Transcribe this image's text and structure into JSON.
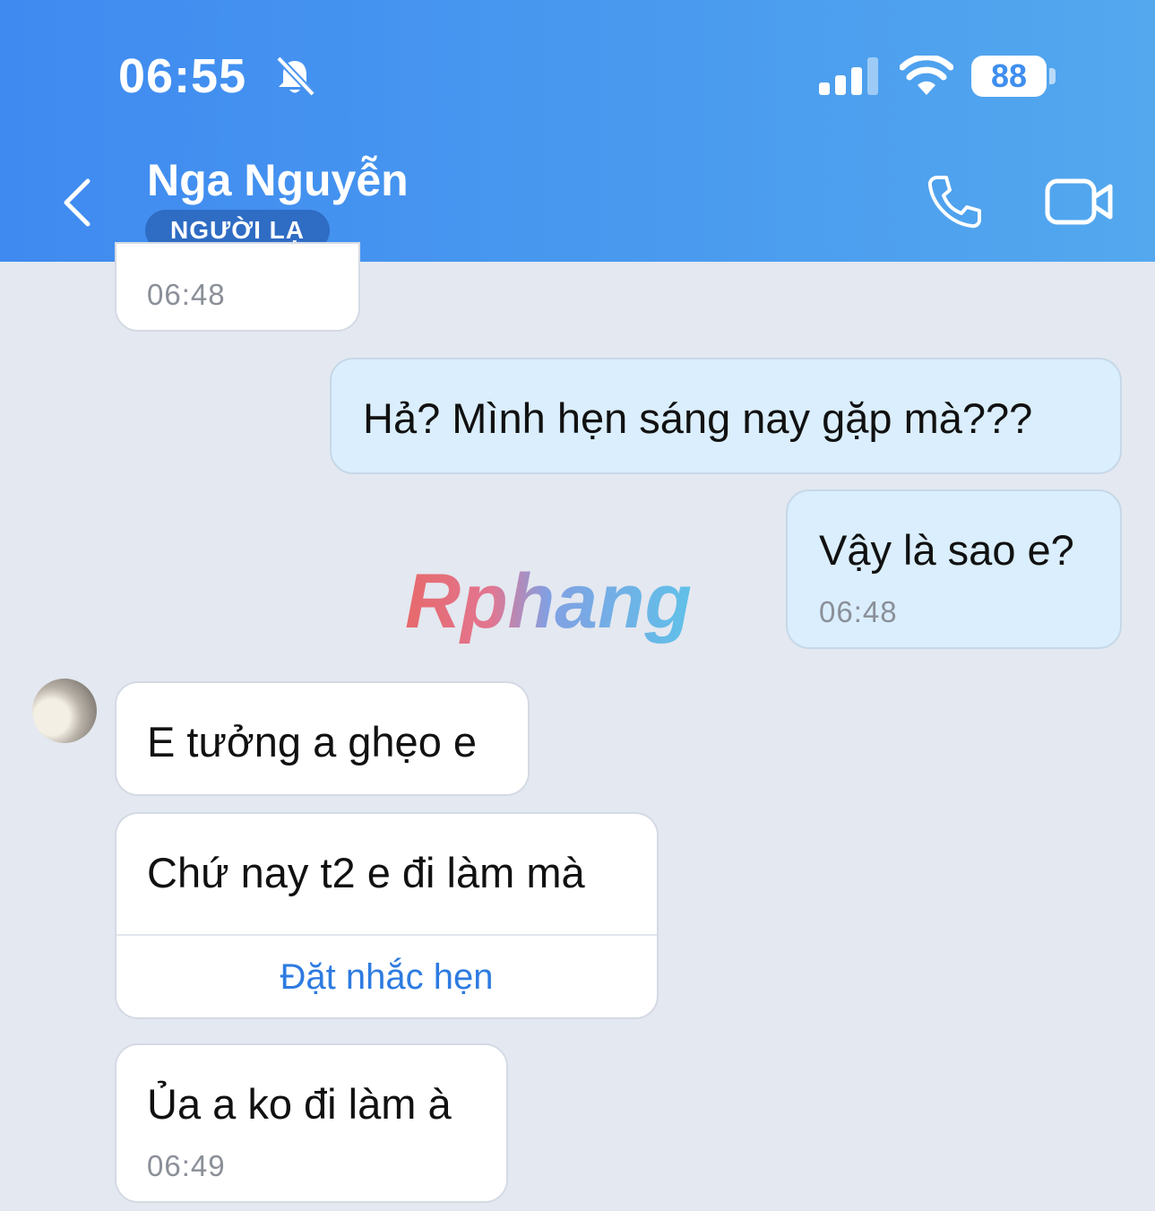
{
  "status_bar": {
    "time": "06:55",
    "battery": "88",
    "icons": [
      "bell-slash-icon",
      "cellular-signal-icon",
      "wifi-icon",
      "battery-icon"
    ]
  },
  "header": {
    "contact_name": "Nga Nguyễn",
    "badge": "NGƯỜI LẠ",
    "icons": [
      "back-chevron-icon",
      "phone-call-icon",
      "video-call-icon"
    ]
  },
  "watermark": "Rphang",
  "messages": [
    {
      "sender": "other",
      "text": "",
      "time": "06:48"
    },
    {
      "sender": "me",
      "text": "Hả? Mình hẹn sáng nay gặp mà???",
      "time": ""
    },
    {
      "sender": "me",
      "text": "Vậy là sao e?",
      "time": "06:48"
    },
    {
      "sender": "other",
      "text": "E tưởng a ghẹo e",
      "time": ""
    },
    {
      "sender": "other",
      "text": "Chứ nay t2 e đi làm mà",
      "time": "",
      "action": "Đặt nhắc hẹn"
    },
    {
      "sender": "other",
      "text": "Ủa a ko đi làm à",
      "time": "06:49"
    }
  ],
  "colors": {
    "header_start": "#3f8af0",
    "header_end": "#53a8ee",
    "badge": "#2f6cc4",
    "chat_background": "#e4e8f0",
    "my_bubble": "#daeefd",
    "their_bubble": "#ffffff",
    "link": "#2e7be0"
  }
}
